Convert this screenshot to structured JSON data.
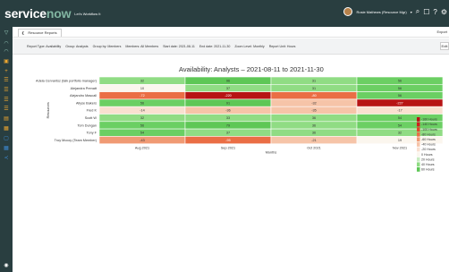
{
  "header": {
    "logo_service": "service",
    "logo_now": "now",
    "tagline": "Let's Workflow It",
    "user_name": "Rosie Mathews (Resource Mgr)",
    "user_caret": "▾"
  },
  "tab": {
    "label": "Resource Reports",
    "chevron": "❮"
  },
  "toolbar": {
    "export_label": "Export",
    "edit_label": "Edit"
  },
  "filters": [
    "Report Type: Availability",
    "Group: Analysts",
    "Group by: Members",
    "Members: All Members",
    "Start date: 2021-08-11",
    "End date: 2021-11-30",
    "Zoom Level: Monthly",
    "Report Unit: Hours"
  ],
  "chart_data": {
    "type": "heatmap",
    "title": "Availability: Analysts – 2021-08-11 to 2021-11-30",
    "xlabel": "Months",
    "ylabel": "Resources",
    "columns": [
      "Aug 2021",
      "Sep 2021",
      "Oct 2021",
      "Nov 2021"
    ],
    "rows": [
      {
        "name": "Adela Cervantsz (talk portfolio manager)",
        "values": [
          32,
          96,
          31,
          56
        ]
      },
      {
        "name": "Alejandra Prenatt",
        "values": [
          10,
          37,
          31,
          56
        ]
      },
      {
        "name": "Alejandro Mascall",
        "values": [
          -72,
          -220,
          -80,
          56
        ]
      },
      {
        "name": "Allyse Bakers",
        "values": [
          56,
          91,
          -32,
          -227
        ]
      },
      {
        "name": "Fred K",
        "values": [
          -14,
          -36,
          -35,
          -17
        ]
      },
      {
        "name": "Scott W",
        "values": [
          32,
          33,
          36,
          54
        ]
      },
      {
        "name": "Tom Dungan",
        "values": [
          56,
          79,
          36,
          54
        ]
      },
      {
        "name": "Tony F",
        "values": [
          54,
          37,
          36,
          32
        ]
      },
      {
        "name": "Troy Mccoy (Team Member)",
        "values": [
          -43,
          -95,
          -21,
          19
        ]
      }
    ],
    "legend": [
      {
        "label": "-160 Hours",
        "color": "#b71414"
      },
      {
        "label": "-140 Hours",
        "color": "#d21d1d"
      },
      {
        "label": "-100 Hours",
        "color": "#e0482c"
      },
      {
        "label": "-80 Hours",
        "color": "#ea6e45"
      },
      {
        "label": "-60 Hours",
        "color": "#f09a74"
      },
      {
        "label": "-40 Hours",
        "color": "#f6c4a8"
      },
      {
        "label": "-20 Hours",
        "color": "#f9e0d0"
      },
      {
        "label": "0 Hours",
        "color": "#fbf6ee"
      },
      {
        "label": "20 Hours",
        "color": "#c9ecc2"
      },
      {
        "label": "40 Hours",
        "color": "#90dc84"
      },
      {
        "label": "60 Hours",
        "color": "#5ec756"
      }
    ]
  }
}
